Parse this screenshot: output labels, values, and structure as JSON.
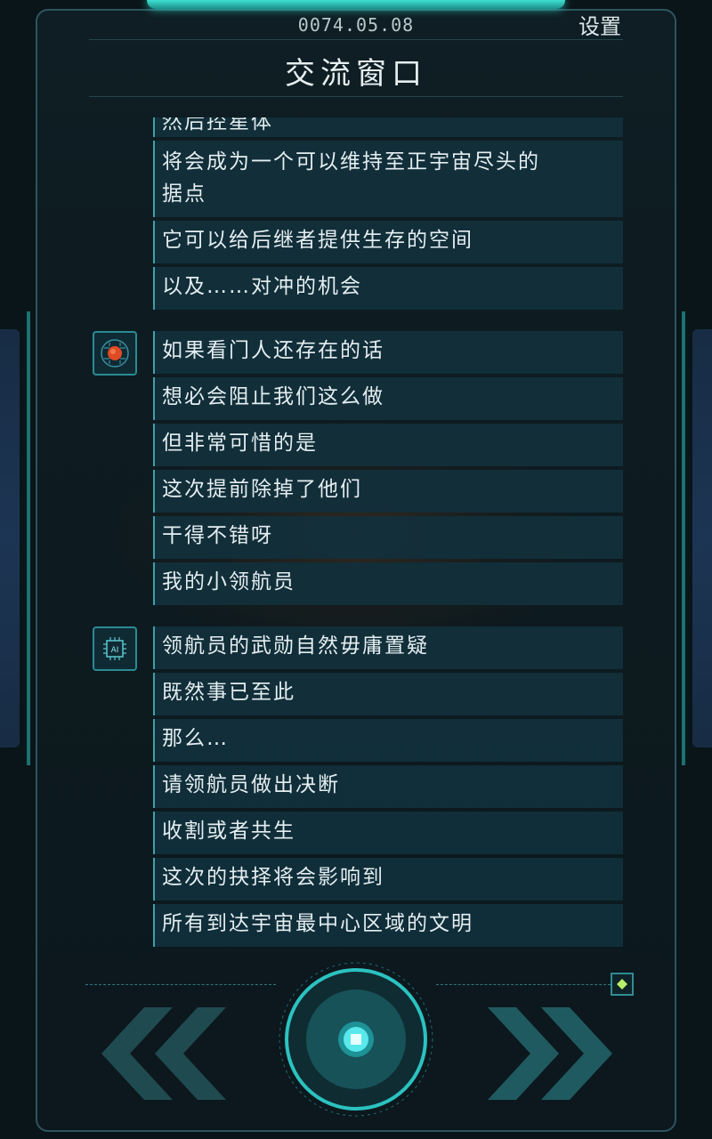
{
  "header": {
    "date": "0074.05.08",
    "settings_label": "设置",
    "title": "交流窗口"
  },
  "messages": {
    "partial_top": "然后控星体",
    "a1": "将会成为一个可以维持至正宇宙尽头的",
    "a1b": "据点",
    "a2": "它可以给后继者提供生存的空间",
    "a3": "以及……对冲的机会",
    "b1": "如果看门人还存在的话",
    "b2": "想必会阻止我们这么做",
    "b3": "但非常可惜的是",
    "b4": "这次提前除掉了他们",
    "b5": "干得不错呀",
    "b6": "我的小领航员",
    "c1": "领航员的武勋自然毋庸置疑",
    "c2": "既然事已至此",
    "c3": "那么…",
    "c4": "请领航员做出决断",
    "c5": "收割或者共生",
    "c6": "这次的抉择将会影响到",
    "c7": "所有到达宇宙最中心区域的文明"
  },
  "icons": {
    "brain_avatar": "brain-circuit-avatar",
    "ai_avatar": "ai-chip-avatar",
    "prev": "double-chevron-left-icon",
    "next": "double-chevron-right-icon",
    "center": "square-dot-icon",
    "small": "diamond-icon"
  },
  "colors": {
    "accent": "#2fc9bd",
    "bubble": "#11303c",
    "bubble_border": "#3fa0a8"
  }
}
